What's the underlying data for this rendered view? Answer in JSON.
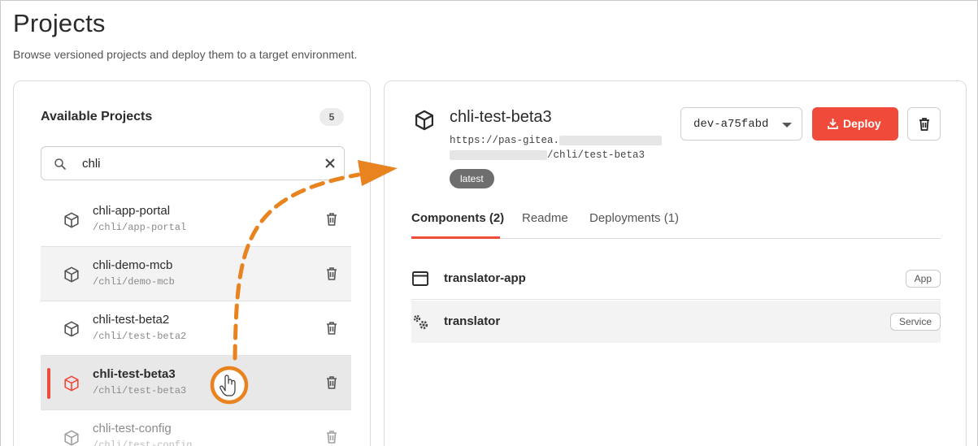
{
  "page": {
    "title": "Projects",
    "subtitle": "Browse versioned projects and deploy them to a target environment."
  },
  "sidebar": {
    "title": "Available Projects",
    "count": "5",
    "search_value": "chli",
    "projects": [
      {
        "name": "chli-app-portal",
        "path": "/chli/app-portal",
        "state": "normal"
      },
      {
        "name": "chli-demo-mcb",
        "path": "/chli/demo-mcb",
        "state": "hover"
      },
      {
        "name": "chli-test-beta2",
        "path": "/chli/test-beta2",
        "state": "normal"
      },
      {
        "name": "chli-test-beta3",
        "path": "/chli/test-beta3",
        "state": "selected"
      },
      {
        "name": "chli-test-config",
        "path": "/chli/test-config",
        "state": "faded"
      }
    ]
  },
  "detail": {
    "name": "chli-test-beta3",
    "url_prefix": "https://pas-gitea.",
    "url_suffix": "/chli/test-beta3",
    "badge": "latest",
    "version": "dev-a75fabd",
    "deploy_label": "Deploy",
    "tabs": [
      {
        "label": "Components (2)",
        "active": true
      },
      {
        "label": "Readme",
        "active": false
      },
      {
        "label": "Deployments (1)",
        "active": false
      }
    ],
    "components": [
      {
        "name": "translator-app",
        "type": "App",
        "icon": "window-icon"
      },
      {
        "name": "translator",
        "type": "Service",
        "icon": "gears-icon"
      }
    ]
  },
  "colors": {
    "accent": "#f04a3a",
    "annotation": "#e8831f",
    "selected_bg": "#e8e8e8"
  }
}
